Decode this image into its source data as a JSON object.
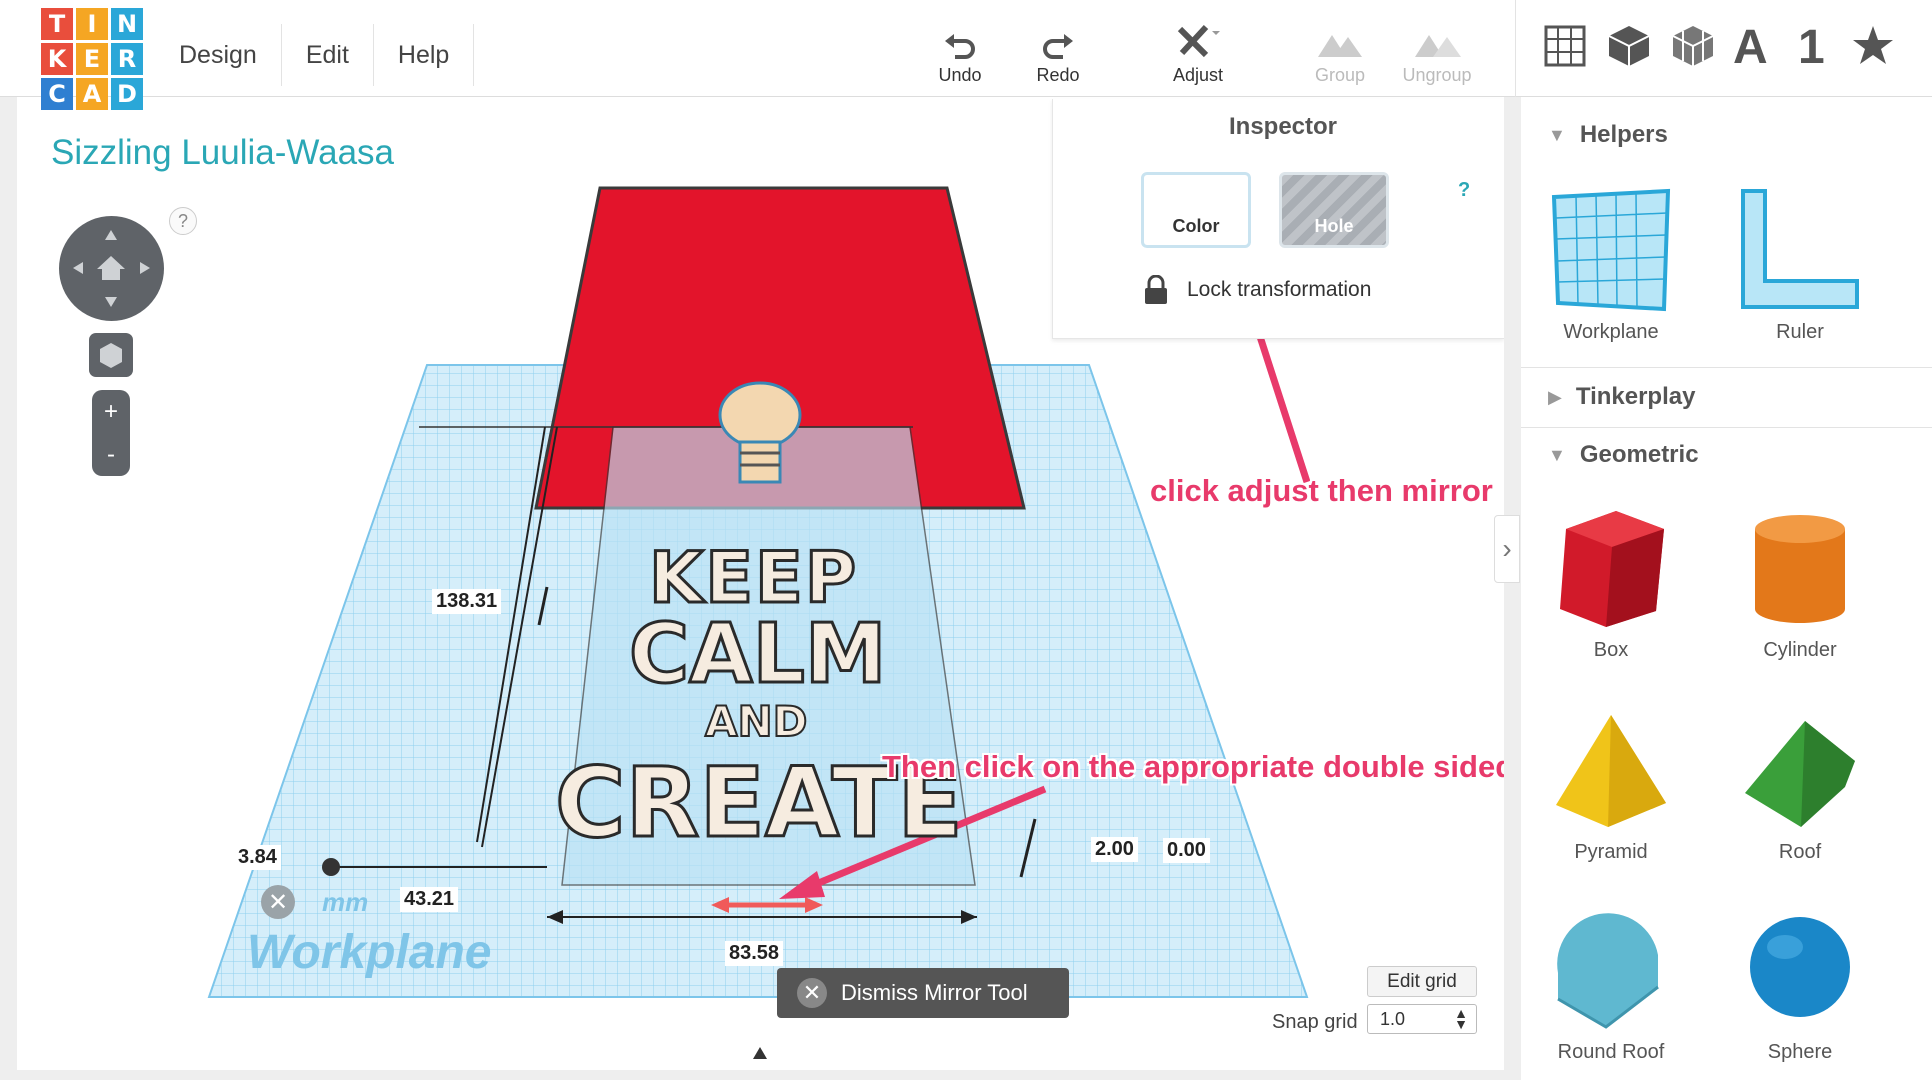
{
  "logo": {
    "letters": [
      "T",
      "I",
      "N",
      "K",
      "E",
      "R",
      "C",
      "A",
      "D"
    ],
    "colors": [
      "#e94e3c",
      "#f5a623",
      "#2aa7d8",
      "#e94e3c",
      "#f5a623",
      "#2aa7d8",
      "#2f7fd1",
      "#f5a623",
      "#2aa7d8"
    ]
  },
  "menu": {
    "items": [
      "Design",
      "Edit",
      "Help"
    ]
  },
  "toolbar": {
    "undo": "Undo",
    "redo": "Redo",
    "adjust": "Adjust",
    "group": "Group",
    "ungroup": "Ungroup"
  },
  "view_icons": {
    "letter": "A",
    "number": "1",
    "icons": [
      "grid-view-icon",
      "box-view-icon",
      "wire-box-icon",
      "text-icon",
      "number-icon",
      "star-icon"
    ]
  },
  "project": {
    "title": "Sizzling Luulia-Waasa"
  },
  "canvas": {
    "help": "?",
    "zoom_in": "+",
    "zoom_out": "-",
    "workplane_label": "Workplane",
    "units": "mm",
    "dimensions": {
      "height": "138.31",
      "left_offset": "3.84",
      "x_offset": "43.21",
      "width": "83.58",
      "elevation": "2.00",
      "z_value": "0.00"
    },
    "sign_text": [
      "KEEP",
      "CALM",
      "AND",
      "CREATE"
    ],
    "shape_color": "#e3142b",
    "grid_color": "#9fd8f2"
  },
  "inspector": {
    "title": "Inspector",
    "color_label": "Color",
    "hole_label": "Hole",
    "help": "?",
    "lock_label": "Lock transformation"
  },
  "annotations": {
    "adjust_hint": "click adjust then mirror",
    "arrow_hint": "Then click on the appropriate double sided arrow",
    "color": "#e83a6b"
  },
  "dismiss": {
    "label": "Dismiss Mirror Tool"
  },
  "grid_controls": {
    "edit_grid": "Edit grid",
    "snap_label": "Snap grid",
    "snap_value": "1.0"
  },
  "sidebar": {
    "helpers": {
      "title": "Helpers",
      "items": [
        "Workplane",
        "Ruler"
      ]
    },
    "tinkerplay": {
      "title": "Tinkerplay"
    },
    "geometric": {
      "title": "Geometric",
      "items": [
        "Box",
        "Cylinder",
        "Pyramid",
        "Roof",
        "Round Roof",
        "Sphere"
      ]
    }
  }
}
